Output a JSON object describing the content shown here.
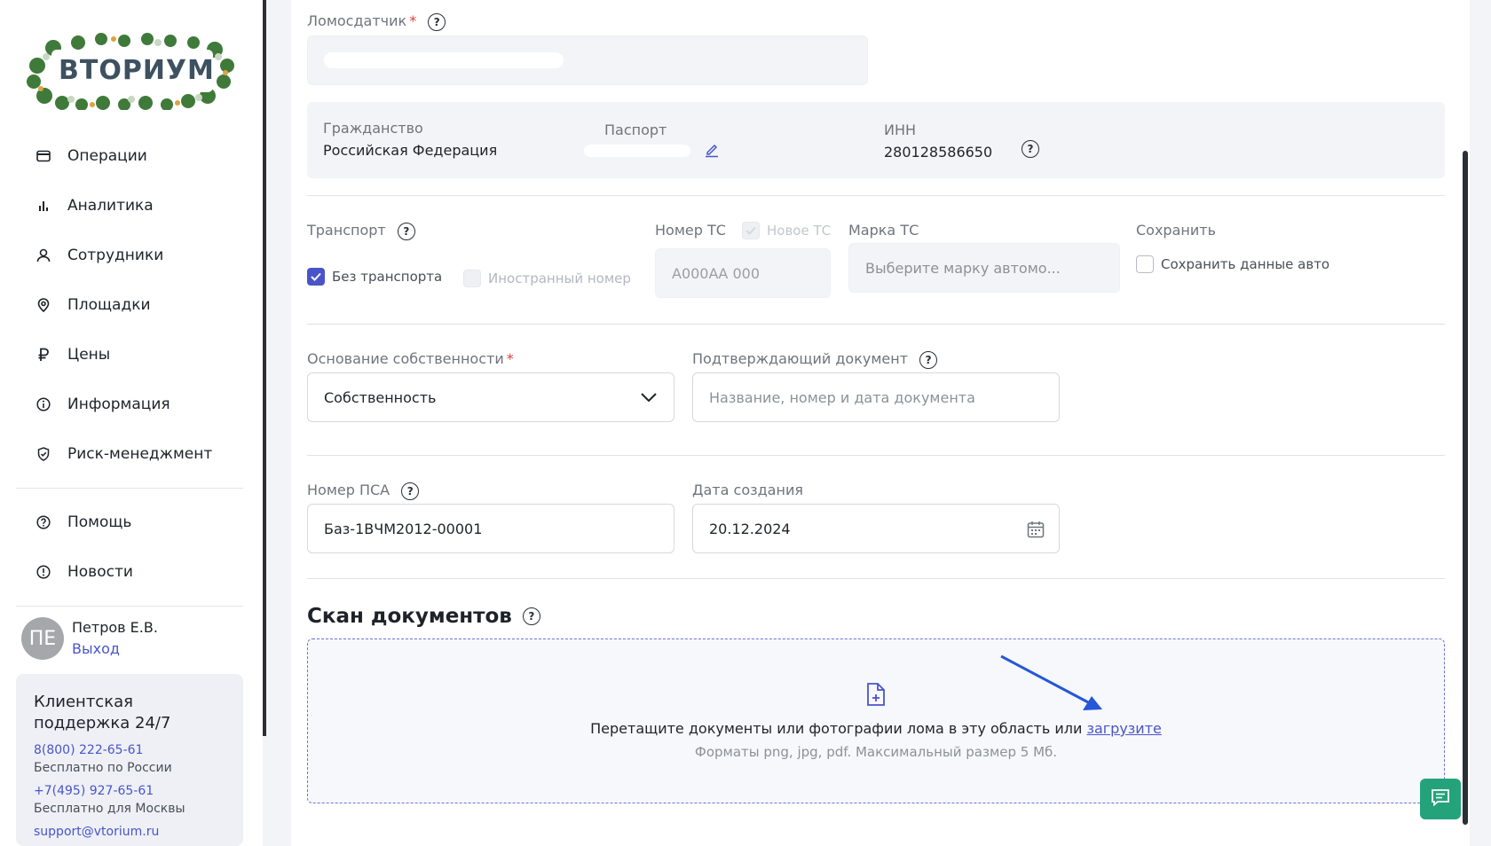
{
  "sidebar": {
    "logo_text": "ВТОРИУМ",
    "nav": [
      {
        "label": "Операции",
        "icon": "card-icon"
      },
      {
        "label": "Аналитика",
        "icon": "bar-chart-icon"
      },
      {
        "label": "Сотрудники",
        "icon": "person-icon"
      },
      {
        "label": "Площадки",
        "icon": "location-pin-icon"
      },
      {
        "label": "Цены",
        "icon": "ruble-icon"
      },
      {
        "label": "Информация",
        "icon": "info-icon"
      },
      {
        "label": "Риск-менеджмент",
        "icon": "shield-check-icon"
      }
    ],
    "nav_secondary": [
      {
        "label": "Помощь",
        "icon": "question-icon"
      },
      {
        "label": "Новости",
        "icon": "alert-icon"
      }
    ],
    "user": {
      "initials": "ПЕ",
      "name": "Петров Е.В.",
      "logout": "Выход"
    },
    "support": {
      "title": "Клиентская поддержка 24/7",
      "phone1": "8(800) 222-65-61",
      "note1": "Бесплатно по России",
      "phone2": "+7(495) 927-65-61",
      "note2": "Бесплатно для Москвы",
      "email": "support@vtorium.ru"
    }
  },
  "form": {
    "seller": {
      "label": "Ломосдатчик",
      "value": ""
    },
    "citizenship": {
      "label": "Гражданство",
      "value": "Российская Федерация"
    },
    "passport": {
      "label": "Паспорт"
    },
    "inn": {
      "label": "ИНН",
      "value": "280128586650"
    },
    "transport": {
      "label": "Транспорт",
      "no_transport": "Без транспорта",
      "foreign_number": "Иностранный номер",
      "vehicle_number_label": "Номер ТС",
      "vehicle_number_placeholder": "А000АА 000",
      "new_vehicle": "Новое ТС",
      "brand_label": "Марка ТС",
      "brand_placeholder": "Выберите марку автомо...",
      "save_label": "Сохранить",
      "save_vehicle_data": "Сохранить данные авто"
    },
    "ownership": {
      "label": "Основание собственности",
      "value": "Собственность"
    },
    "confirm_doc": {
      "label": "Подтверждающий документ",
      "placeholder": "Название, номер и дата документа"
    },
    "psa_number": {
      "label": "Номер ПСА",
      "value": "Баз-1ВЧМ2012-00001"
    },
    "created_date": {
      "label": "Дата создания",
      "value": "20.12.2024"
    }
  },
  "scan": {
    "title": "Скан документов",
    "drop_text": "Перетащите документы или фотографии лома в эту область или",
    "upload_link": "загрузите",
    "formats": "Форматы png, jpg, pdf. Максимальный размер 5 Мб."
  },
  "colors": {
    "accent": "#4a54c9",
    "chat": "#24a37b",
    "required": "#e23b3b"
  }
}
